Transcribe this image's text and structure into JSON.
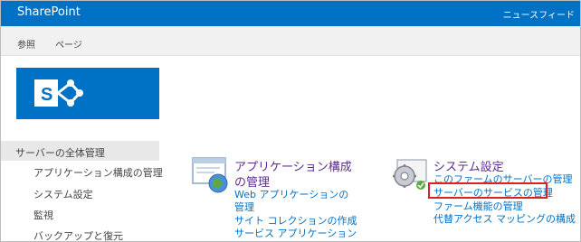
{
  "suite_bar": {
    "brand": "SharePoint",
    "news_feed": "ニュースフィード"
  },
  "ribbon": {
    "tabs": [
      "参照",
      "ページ"
    ]
  },
  "colors": {
    "suite_bar": "#0072c6",
    "section_title": "#5c2d91",
    "link": "#0072c6",
    "highlight_box": "#e01f1f"
  },
  "quick_launch": {
    "title": "サーバーの全体管理",
    "items": [
      "アプリケーション構成の管理",
      "システム設定",
      "監視",
      "バックアップと復元"
    ]
  },
  "sections": [
    {
      "icon": "application-config-icon",
      "title_line1": "アプリケーション構成",
      "title_line2": "の管理",
      "links": [
        "Web アプリケーションの",
        "管理",
        "サイト コレクションの作成",
        "サービス アプリケーション"
      ]
    },
    {
      "icon": "system-settings-icon",
      "title": "システム設定",
      "links": [
        "このファームのサーバーの管理",
        "サーバーのサービスの管理",
        "ファーム機能の管理",
        "代替アクセス マッピングの構成"
      ],
      "highlighted_link_index": 1
    }
  ]
}
